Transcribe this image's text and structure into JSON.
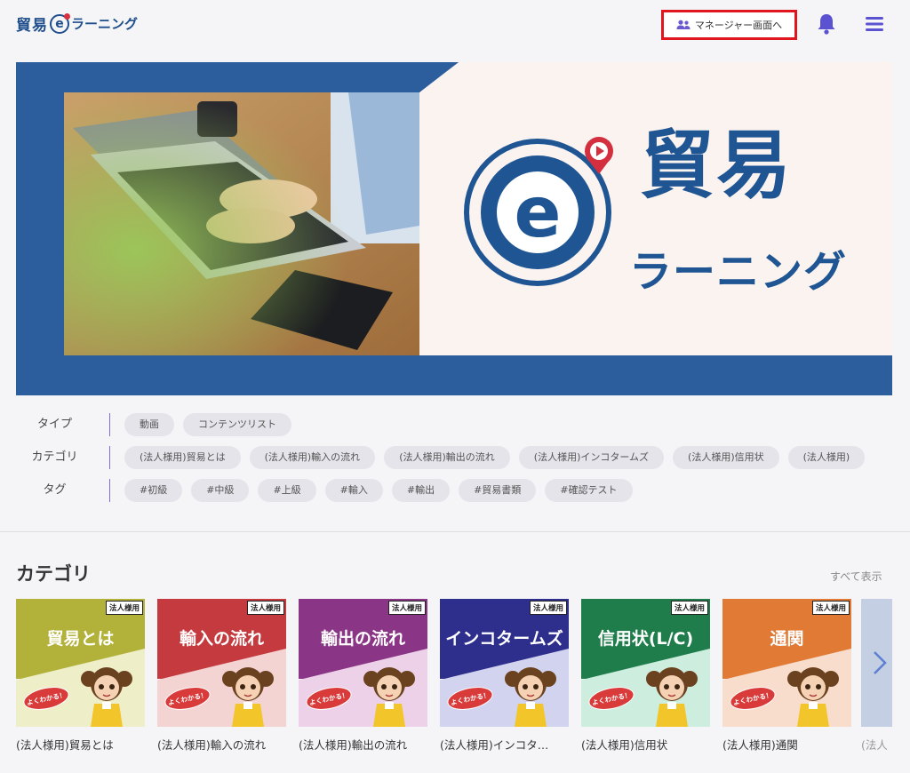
{
  "header": {
    "logo_kanji": "貿易",
    "logo_e": "e",
    "logo_kana": "ラーニング",
    "manager_button": "マネージャー画面へ",
    "icons": [
      "users-icon",
      "bell-icon",
      "menu-icon"
    ]
  },
  "hero": {
    "kanji": "貿易",
    "kana": "ラーニング",
    "logo_letter": "e"
  },
  "filters": {
    "type": {
      "label": "タイプ",
      "chips": [
        "動画",
        "コンテンツリスト"
      ]
    },
    "category": {
      "label": "カテゴリ",
      "chips": [
        "(法人様用)貿易とは",
        "(法人様用)輸入の流れ",
        "(法人様用)輸出の流れ",
        "(法人様用)インコタームズ",
        "(法人様用)信用状",
        "(法人様用)"
      ]
    },
    "tag": {
      "label": "タグ",
      "chips": [
        "#初級",
        "#中級",
        "#上級",
        "#輸入",
        "#輸出",
        "#貿易書類",
        "#確認テスト"
      ]
    }
  },
  "section": {
    "title": "カテゴリ",
    "show_all": "すべて表示"
  },
  "cards": [
    {
      "badge": "法人様用",
      "title": "貿易とは",
      "bubble": "よくわかる！",
      "label": "(法人様用)貿易とは",
      "top": "#b2b13a",
      "bottom": "#eeeec9"
    },
    {
      "badge": "法人様用",
      "title": "輸入の流れ",
      "bubble": "よくわかる！",
      "label": "(法人様用)輸入の流れ",
      "top": "#c43a3e",
      "bottom": "#f4d3d3"
    },
    {
      "badge": "法人様用",
      "title": "輸出の流れ",
      "bubble": "よくわかる！",
      "label": "(法人様用)輸出の流れ",
      "top": "#8a3585",
      "bottom": "#ecd1e9"
    },
    {
      "badge": "法人様用",
      "title": "インコタームズ",
      "bubble": "よくわかる！",
      "label": "(法人様用)インコタ…",
      "top": "#2e2f8c",
      "bottom": "#d2d3ef"
    },
    {
      "badge": "法人様用",
      "title": "信用状(L/C)",
      "bubble": "よくわかる！",
      "label": "(法人様用)信用状",
      "top": "#1f7d4c",
      "bottom": "#cdeede"
    },
    {
      "badge": "法人様用",
      "title": "通関",
      "bubble": "よくわかる！",
      "label": "(法人様用)通関",
      "top": "#e07a35",
      "bottom": "#f8ddcc"
    }
  ],
  "partial_card_label": "(法人"
}
